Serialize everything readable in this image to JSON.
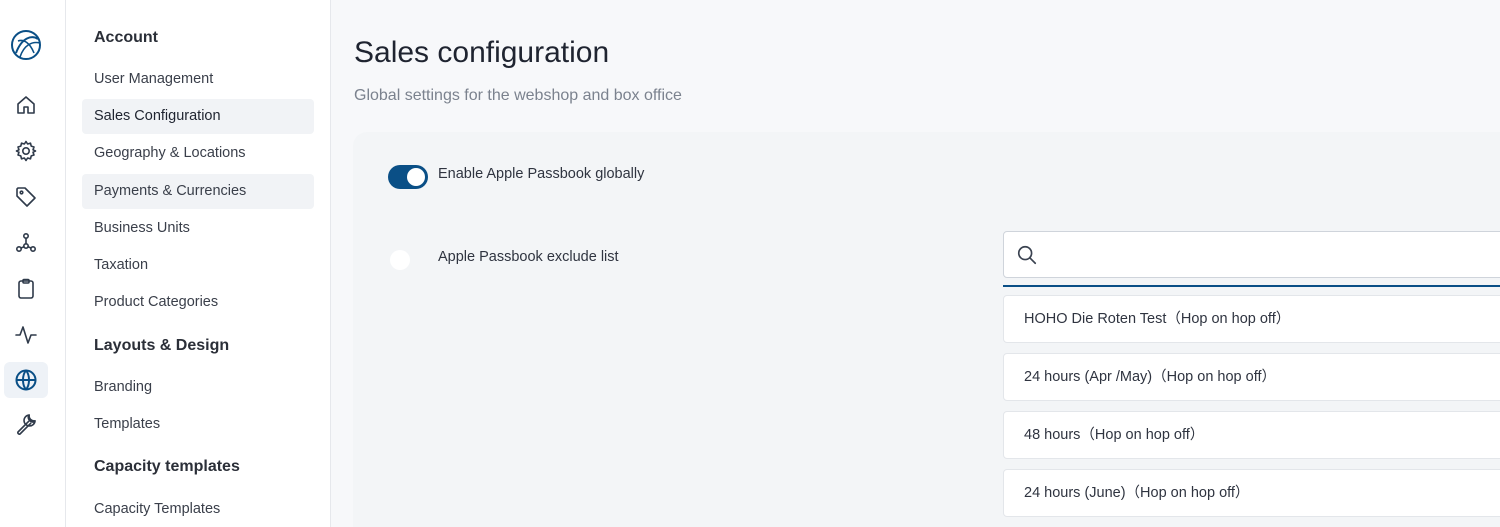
{
  "rail": {
    "icons": [
      "logo-icon",
      "home-icon",
      "gear-icon",
      "tag-icon",
      "network-icon",
      "clipboard-icon",
      "activity-icon",
      "globe-icon",
      "wrench-icon"
    ],
    "active": "globe-icon",
    "accent": "#0a4f86"
  },
  "nav": {
    "sections": [
      {
        "title": "Account",
        "items": [
          "User Management",
          "Sales Configuration",
          "Geography & Locations",
          "Payments & Currencies",
          "Business Units",
          "Taxation",
          "Product Categories"
        ]
      },
      {
        "title": "Layouts & Design",
        "items": [
          "Branding",
          "Templates"
        ]
      },
      {
        "title": "Capacity templates",
        "items": [
          "Capacity Templates"
        ]
      }
    ],
    "active_item": "Sales Configuration"
  },
  "page": {
    "title": "Sales configuration",
    "subtitle": "Global settings for the webshop and box office"
  },
  "settings": {
    "passbook_toggle": {
      "label": "Enable Apple Passbook globally",
      "enabled": true
    },
    "exclude_list": {
      "label": "Apple Passbook exclude list",
      "selected": false
    },
    "search": {
      "value": "",
      "placeholder": ""
    },
    "options": [
      "HOHO Die Roten Test（Hop on hop off）",
      "24 hours (Apr /May)（Hop on hop off）",
      "48 hours（Hop on hop off）",
      "24 hours (June)（Hop on hop off）"
    ]
  }
}
